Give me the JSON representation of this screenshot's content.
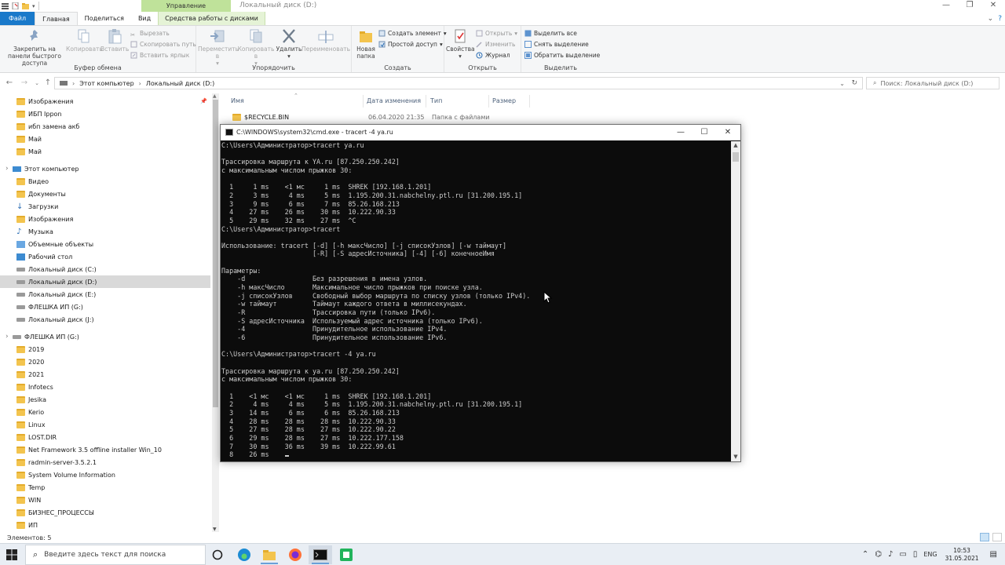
{
  "explorer": {
    "window_title": "Локальный диск (D:)",
    "management_label": "Управление",
    "tabs": [
      "Файл",
      "Главная",
      "Поделиться",
      "Вид",
      "Средства работы с дисками"
    ],
    "ribbon": {
      "clipboard": {
        "label": "Буфер обмена",
        "pin": "Закрепить на панели быстрого доступа",
        "copy": "Копировать",
        "paste": "Вставить",
        "cut": "Вырезать",
        "copy_path": "Скопировать путь",
        "paste_shortcut": "Вставить ярлык"
      },
      "organize": {
        "label": "Упорядочить",
        "move_to": "Переместить в",
        "copy_to": "Копировать в",
        "delete": "Удалить",
        "rename": "Переименовать"
      },
      "create": {
        "label": "Создать",
        "new_folder": "Новая папка",
        "new_item": "Создать элемент",
        "easy_access": "Простой доступ"
      },
      "open": {
        "label": "Открыть",
        "properties": "Свойства",
        "open": "Открыть",
        "edit": "Изменить",
        "history": "Журнал"
      },
      "select": {
        "label": "Выделить",
        "select_all": "Выделить все",
        "select_none": "Снять выделение",
        "invert": "Обратить выделение"
      }
    },
    "address": {
      "crumb1": "Этот компьютер",
      "crumb2": "Локальный диск (D:)",
      "search_placeholder": "Поиск: Локальный диск (D:)"
    },
    "nav_items": [
      {
        "label": "Изображения",
        "type": "folder",
        "indent": 1,
        "pinned": true
      },
      {
        "label": "ИБП Ippon",
        "type": "folder",
        "indent": 1
      },
      {
        "label": "ибп замена акб",
        "type": "folder",
        "indent": 1
      },
      {
        "label": "Май",
        "type": "folder",
        "indent": 1
      },
      {
        "label": "Май",
        "type": "folder",
        "indent": 1
      },
      {
        "label": "",
        "type": "gap",
        "indent": 0
      },
      {
        "label": "Этот компьютер",
        "type": "pc",
        "indent": 0
      },
      {
        "label": "Видео",
        "type": "folder",
        "indent": 1
      },
      {
        "label": "Документы",
        "type": "folder",
        "indent": 1
      },
      {
        "label": "Загрузки",
        "type": "download",
        "indent": 1
      },
      {
        "label": "Изображения",
        "type": "folder",
        "indent": 1
      },
      {
        "label": "Музыка",
        "type": "music",
        "indent": 1
      },
      {
        "label": "Объемные объекты",
        "type": "folder3d",
        "indent": 1
      },
      {
        "label": "Рабочий стол",
        "type": "desktop",
        "indent": 1
      },
      {
        "label": "Локальный диск (C:)",
        "type": "drive",
        "indent": 1
      },
      {
        "label": "Локальный диск (D:)",
        "type": "drive",
        "indent": 1,
        "selected": true
      },
      {
        "label": "Локальный диск (E:)",
        "type": "drive",
        "indent": 1
      },
      {
        "label": "ФЛЕШКА ИП (G:)",
        "type": "drive",
        "indent": 1
      },
      {
        "label": "Локальный диск (J:)",
        "type": "drive",
        "indent": 1
      },
      {
        "label": "",
        "type": "gap",
        "indent": 0
      },
      {
        "label": "ФЛЕШКА ИП (G:)",
        "type": "drive",
        "indent": 0
      },
      {
        "label": "2019",
        "type": "folder",
        "indent": 1
      },
      {
        "label": "2020",
        "type": "folder",
        "indent": 1
      },
      {
        "label": "2021",
        "type": "folder",
        "indent": 1
      },
      {
        "label": "Infotecs",
        "type": "folder",
        "indent": 1
      },
      {
        "label": "Jesika",
        "type": "folder",
        "indent": 1
      },
      {
        "label": "Kerio",
        "type": "folder",
        "indent": 1
      },
      {
        "label": "Linux",
        "type": "folder",
        "indent": 1
      },
      {
        "label": "LOST.DIR",
        "type": "folder",
        "indent": 1
      },
      {
        "label": "Net Framework 3.5 offline installer Win_10",
        "type": "folder",
        "indent": 1
      },
      {
        "label": "radmin-server-3.5.2.1",
        "type": "folder",
        "indent": 1
      },
      {
        "label": "System Volume Information",
        "type": "folder",
        "indent": 1
      },
      {
        "label": "Temp",
        "type": "folder",
        "indent": 1
      },
      {
        "label": "WIN",
        "type": "folder",
        "indent": 1
      },
      {
        "label": "БИЗНЕС_ПРОЦЕССЫ",
        "type": "folder",
        "indent": 1
      },
      {
        "label": "ИП",
        "type": "folder",
        "indent": 1
      }
    ],
    "columns": [
      "Имя",
      "Дата изменения",
      "Тип",
      "Размер"
    ],
    "files": [
      {
        "name": "$RECYCLE.BIN",
        "date": "06.04.2020 21:35",
        "type": "Папка с файлами",
        "size": ""
      }
    ],
    "status": "Элементов: 5"
  },
  "cmd": {
    "title": "C:\\WINDOWS\\system32\\cmd.exe - tracert  -4 ya.ru",
    "lines": [
      "C:\\Users\\Администратор>tracert ya.ru",
      "",
      "Трассировка маршрута к YA.ru [87.250.250.242]",
      "с максимальным числом прыжков 30:",
      "",
      "  1     1 ms    <1 мс     1 ms  SHREK [192.168.1.201]",
      "  2     3 ms     4 ms     5 ms  1.195.200.31.nabchelny.ptl.ru [31.200.195.1]",
      "  3     9 ms     6 ms     7 ms  85.26.168.213",
      "  4    27 ms    26 ms    30 ms  10.222.90.33",
      "  5    29 ms    32 ms    27 ms  ^C",
      "C:\\Users\\Администратор>tracert",
      "",
      "Использование: tracert [-d] [-h максЧисло] [-j списокУзлов] [-w таймаут]",
      "                       [-R] [-S адресИсточника] [-4] [-6] конечноеИмя",
      "",
      "Параметры:",
      "    -d                 Без разрешения в имена узлов.",
      "    -h максЧисло       Максимальное число прыжков при поиске узла.",
      "    -j списокУзлов     Свободный выбор маршрута по списку узлов (только IPv4).",
      "    -w таймаут         Таймаут каждого ответа в миллисекундах.",
      "    -R                 Трассировка пути (только IPv6).",
      "    -S адресИсточника  Используемый адрес источника (только IPv6).",
      "    -4                 Принудительное использование IPv4.",
      "    -6                 Принудительное использование IPv6.",
      "",
      "C:\\Users\\Администратор>tracert -4 ya.ru",
      "",
      "Трассировка маршрута к ya.ru [87.250.250.242]",
      "с максимальным числом прыжков 30:",
      "",
      "  1    <1 мс    <1 мс     1 ms  SHREK [192.168.1.201]",
      "  2     4 ms     4 ms     5 ms  1.195.200.31.nabchelny.ptl.ru [31.200.195.1]",
      "  3    14 ms     6 ms     6 ms  85.26.168.213",
      "  4    28 ms    28 ms    28 ms  10.222.90.33",
      "  5    27 ms    28 ms    27 ms  10.222.90.22",
      "  6    29 ms    28 ms    27 ms  10.222.177.158",
      "  7    30 ms    36 ms    39 ms  10.222.99.61",
      "  8    26 ms    "
    ]
  },
  "taskbar": {
    "search_placeholder": "Введите здесь текст для поиска",
    "lang": "ENG",
    "time": "10:53",
    "date": "31.05.2021"
  },
  "colors": {
    "file_tab": "#1979ca",
    "tools_tab": "#e5f3d6",
    "management": "#bfe29a",
    "console_bg": "#0c0c0c",
    "console_text": "#cccccc",
    "selection": "#d9d9d9"
  }
}
